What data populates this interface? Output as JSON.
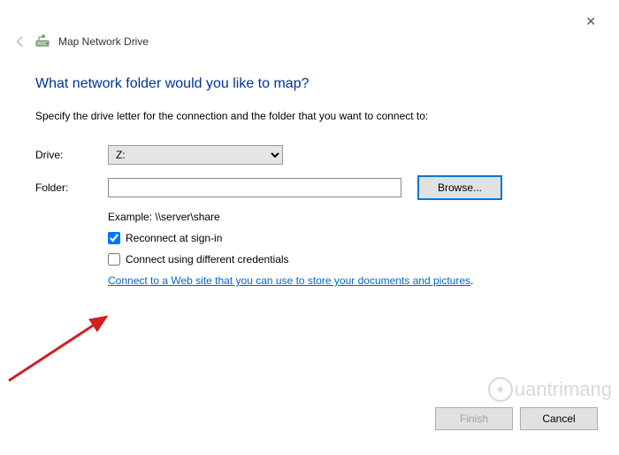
{
  "window": {
    "title": "Map Network Drive"
  },
  "heading": "What network folder would you like to map?",
  "instruction": "Specify the drive letter for the connection and the folder that you want to connect to:",
  "fields": {
    "drive_label": "Drive:",
    "drive_value": "Z:",
    "folder_label": "Folder:",
    "folder_value": "",
    "browse_label": "Browse..."
  },
  "example": "Example: \\\\server\\share",
  "checkboxes": {
    "reconnect_label": "Reconnect at sign-in",
    "reconnect_checked": true,
    "credentials_label": "Connect using different credentials",
    "credentials_checked": false
  },
  "link": {
    "text": "Connect to a Web site that you can use to store your documents and pictures",
    "suffix": "."
  },
  "footer": {
    "finish_label": "Finish",
    "cancel_label": "Cancel"
  },
  "watermark": "uantrimang"
}
